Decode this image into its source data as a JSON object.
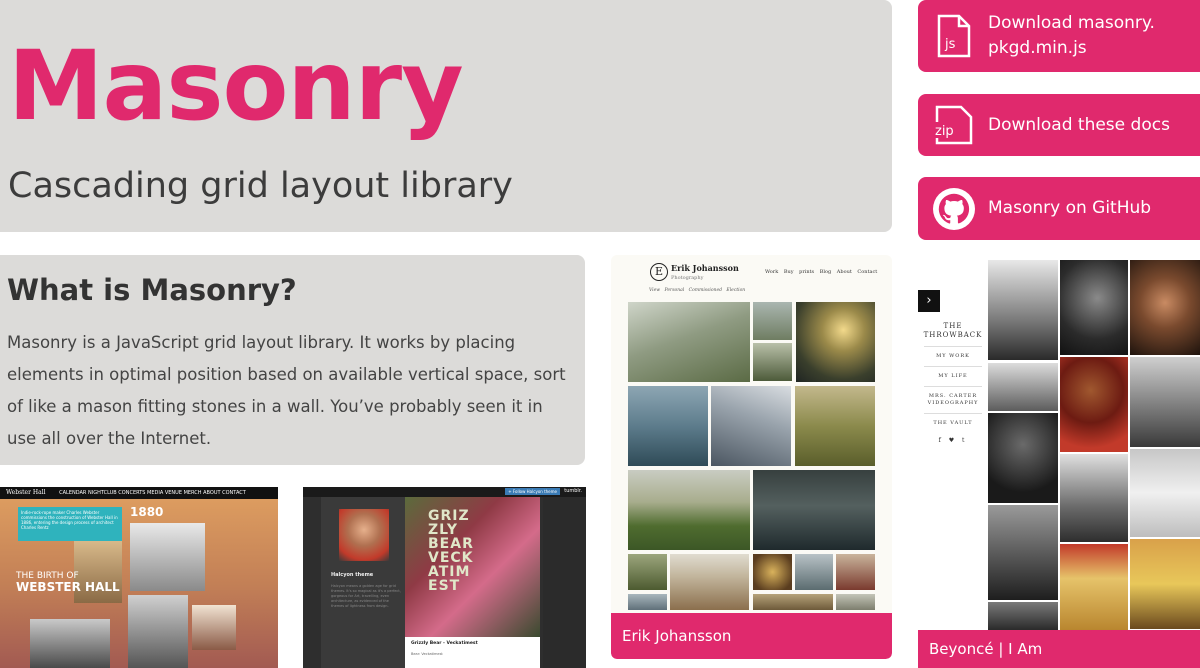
{
  "hero": {
    "title": "Masonry",
    "tagline": "Cascading grid layout library"
  },
  "buttons": [
    {
      "label": "Download masonry.\npkgd.min.js",
      "icon": "js-file-icon"
    },
    {
      "label": "Download these docs",
      "icon": "zip-file-icon"
    },
    {
      "label": "Masonry on GitHub",
      "icon": "github-icon"
    }
  ],
  "what": {
    "heading": "What is Masonry?",
    "body": "Masonry is a JavaScript grid layout library. It works by placing elements in optimal position based on available vertical space, sort of like a mason fitting stones in a wall. You’ve probably seen it in use all over the Internet."
  },
  "icon_text": {
    "js": "js",
    "zip": "zip"
  },
  "showcase": {
    "erik": {
      "caption": "Erik Johansson",
      "logo_letter": "E",
      "site_name": "Erik Johansson",
      "site_sub": "Photography",
      "nav": "Work  Buy prints  Blog  About  Contact",
      "sub_nav": "View  Personal  Commissioned  Election"
    },
    "beyonce": {
      "caption": "Beyoncé | I Am",
      "arrow": "›",
      "side_title": "THE\nTHROWBACK",
      "side_items": [
        "MY WORK",
        "MY LIFE",
        "MRS. CARTER VIDEOGRAPHY",
        "THE VAULT"
      ],
      "social": "f ♥ t"
    },
    "webster": {
      "logo": "Webster Hall",
      "nav": "CALENDAR  NIGHTCLUB  CONCERTS  MEDIA  VENUE  MERCH  ABOUT  CONTACT",
      "tweet": "Indie-rock-rope maker Charles Webster commissions the construction of Webster Hall in 1886, entering the design process of architect Charles Rentz",
      "year": "1880",
      "birth_line1": "THE BIRTH OF",
      "birth_line2": "WEBSTER HALL"
    },
    "halcyon": {
      "theme_label": "Halcyon theme",
      "lorem": "Halcyon means a golden age for grid themes. It's so magical as it's a perfect, gorgeous for Art, travelling, even architecture, as evidenced of the themes of lightness from design.",
      "grizzly": "GRIZ\nZLY\nBEAR\nVECK\nATIM\nEST",
      "post_title": "Grizzly Bear - Veckatimest",
      "post_by": "Bear: Veckatimest",
      "tumblr": "tumblr.",
      "follow": "+ Follow Halcyon theme"
    }
  },
  "colors": {
    "accent": "#e0296d",
    "panel": "#dcdbd9",
    "text": "#333333"
  }
}
